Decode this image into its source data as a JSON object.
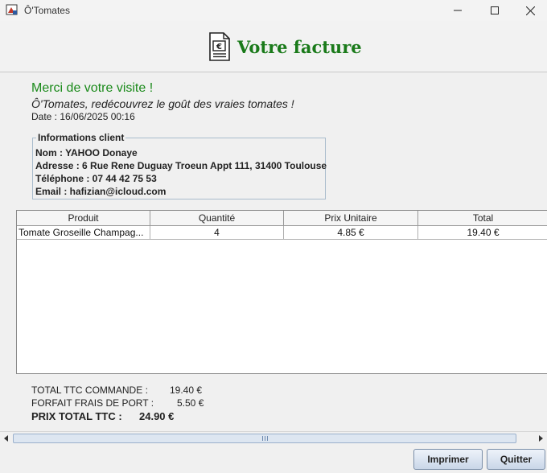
{
  "window": {
    "title": "Ô'Tomates",
    "icon": "app-logo-icon",
    "controls": [
      "minimize-icon",
      "maximize-icon",
      "close-icon"
    ]
  },
  "header": {
    "title": "Votre facture",
    "icon": "invoice-euro-icon",
    "title_color": "#1a7a1a"
  },
  "greeting": {
    "thanks": "Merci de votre visite !",
    "slogan": "Ô'Tomates, redécouvrez le goût des vraies tomates !",
    "date": "Date : 16/06/2025 00:16"
  },
  "client": {
    "legend": "Informations client",
    "name": "Nom : YAHOO Donaye",
    "address": "Adresse : 6 Rue Rene Duguay Troeun Appt 111, 31400 Toulouse",
    "phone": "Téléphone : 07 44 42 75 53",
    "email": "Email : hafizian@icloud.com"
  },
  "table": {
    "columns": [
      "Produit",
      "Quantité",
      "Prix Unitaire",
      "Total"
    ],
    "rows": [
      [
        "Tomate Groseille Champag...",
        "4",
        "4.85 €",
        "19.40 €"
      ]
    ]
  },
  "totals": {
    "commande_label": "TOTAL TTC COMMANDE :",
    "commande_value": "19.40 €",
    "frais_label": "FORFAIT FRAIS DE PORT :",
    "frais_value": "5.50 €",
    "total_label": "PRIX TOTAL TTC :",
    "total_value": "24.90 €"
  },
  "buttons": {
    "print": "Imprimer",
    "quit": "Quitter"
  },
  "colors": {
    "accent_green": "#1a8a1a",
    "button_border": "#7a8ea8"
  }
}
